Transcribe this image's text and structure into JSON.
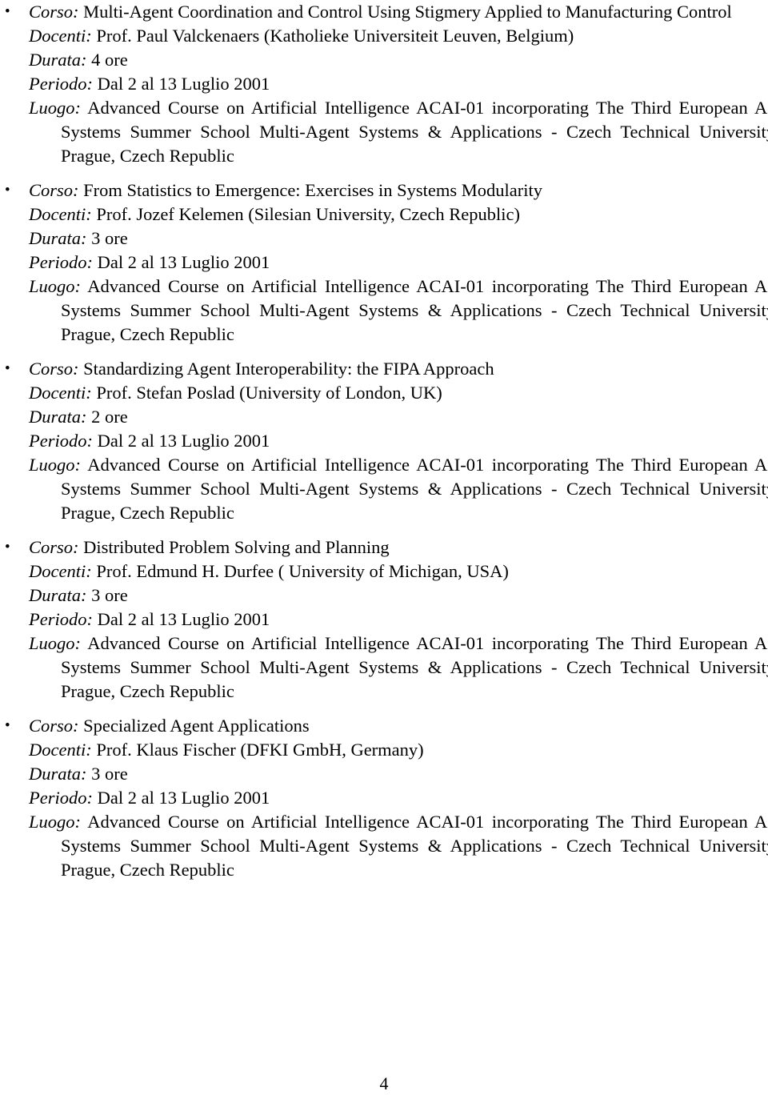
{
  "document": {
    "page_number": "4",
    "labels": {
      "corso": "Corso:",
      "docenti": "Docenti:",
      "durata": "Durata:",
      "periodo": "Periodo:",
      "luogo": "Luogo:"
    },
    "bullet_glyph": "•",
    "courses": [
      {
        "corso": "Multi-Agent Coordination and Control Using Stigmery Applied to Manufacturing Control",
        "docenti": "Prof. Paul Valckenaers (Katholieke Universiteit Leuven, Belgium)",
        "durata": "4 ore",
        "periodo": "Dal 2 al 13 Luglio 2001",
        "luogo": "Advanced Course on Artificial Intelligence ACAI-01 incorporating The Third European Agent Systems Summer School Multi-Agent Systems & Applications - Czech Technical University in Prague, Czech Republic"
      },
      {
        "corso": "From Statistics to Emergence: Exercises in Systems Modularity",
        "docenti": "Prof. Jozef Kelemen (Silesian University, Czech Republic)",
        "durata": "3 ore",
        "periodo": "Dal 2 al 13 Luglio 2001",
        "luogo": "Advanced Course on Artificial Intelligence ACAI-01 incorporating The Third European Agent Systems Summer School Multi-Agent Systems & Applications - Czech Technical University in Prague, Czech Republic"
      },
      {
        "corso": "Standardizing Agent Interoperability: the FIPA Approach",
        "docenti": "Prof. Stefan Poslad (University of London, UK)",
        "durata": "2 ore",
        "periodo": "Dal 2 al 13 Luglio 2001",
        "luogo": "Advanced Course on Artificial Intelligence ACAI-01 incorporating The Third European Agent Systems Summer School Multi-Agent Systems & Applications - Czech Technical University in Prague, Czech Republic"
      },
      {
        "corso": "Distributed Problem Solving and Planning",
        "docenti": "Prof. Edmund H. Durfee ( University of Michigan, USA)",
        "durata": "3 ore",
        "periodo": "Dal 2 al 13 Luglio 2001",
        "luogo": "Advanced Course on Artificial Intelligence ACAI-01 incorporating The Third European Agent Systems Summer School Multi-Agent Systems & Applications - Czech Technical University in Prague, Czech Republic"
      },
      {
        "corso": "Specialized Agent Applications",
        "docenti": "Prof. Klaus Fischer (DFKI GmbH, Germany)",
        "durata": "3 ore",
        "periodo": "Dal 2 al 13 Luglio 2001",
        "luogo": "Advanced Course on Artificial Intelligence ACAI-01 incorporating The Third European Agent Systems Summer School Multi-Agent Systems & Applications - Czech Technical University in Prague, Czech Republic"
      }
    ]
  }
}
